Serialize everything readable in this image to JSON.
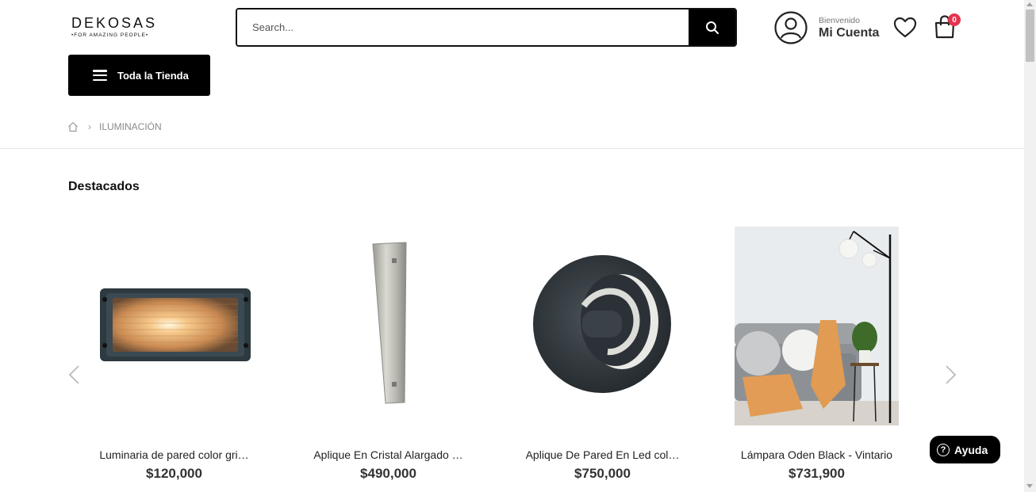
{
  "header": {
    "logo_text": "DEKOSAS",
    "logo_tagline": "•FOR AMAZING PEOPLE•",
    "search_placeholder": "Search...",
    "search_icon": "magnifier-icon",
    "account_welcome": "Bienvenido",
    "account_name": "Mi Cuenta",
    "account_icon": "user-circle-icon",
    "wishlist_icon": "heart-icon",
    "cart_icon": "shopping-bag-icon",
    "cart_count": "0",
    "cart_badge_color": "#e5334e"
  },
  "nav": {
    "store_button_label": "Toda la Tienda",
    "store_button_icon": "hamburger-icon"
  },
  "breadcrumb": {
    "home_icon": "home-icon",
    "current": "ILUMINACIÓN"
  },
  "section": {
    "title": "Destacados"
  },
  "products": [
    {
      "name": "Luminaria de pared color gri…",
      "price": "$120,000"
    },
    {
      "name": "Aplique En Cristal Alargado …",
      "price": "$490,000"
    },
    {
      "name": "Aplique De Pared En Led col…",
      "price": "$750,000"
    },
    {
      "name": "Lámpara Oden Black - Vintario",
      "price": "$731,900"
    }
  ],
  "carousel": {
    "prev_icon": "chevron-left-icon",
    "next_icon": "chevron-right-icon"
  },
  "help": {
    "label": "Ayuda",
    "icon": "question-circle-icon"
  }
}
